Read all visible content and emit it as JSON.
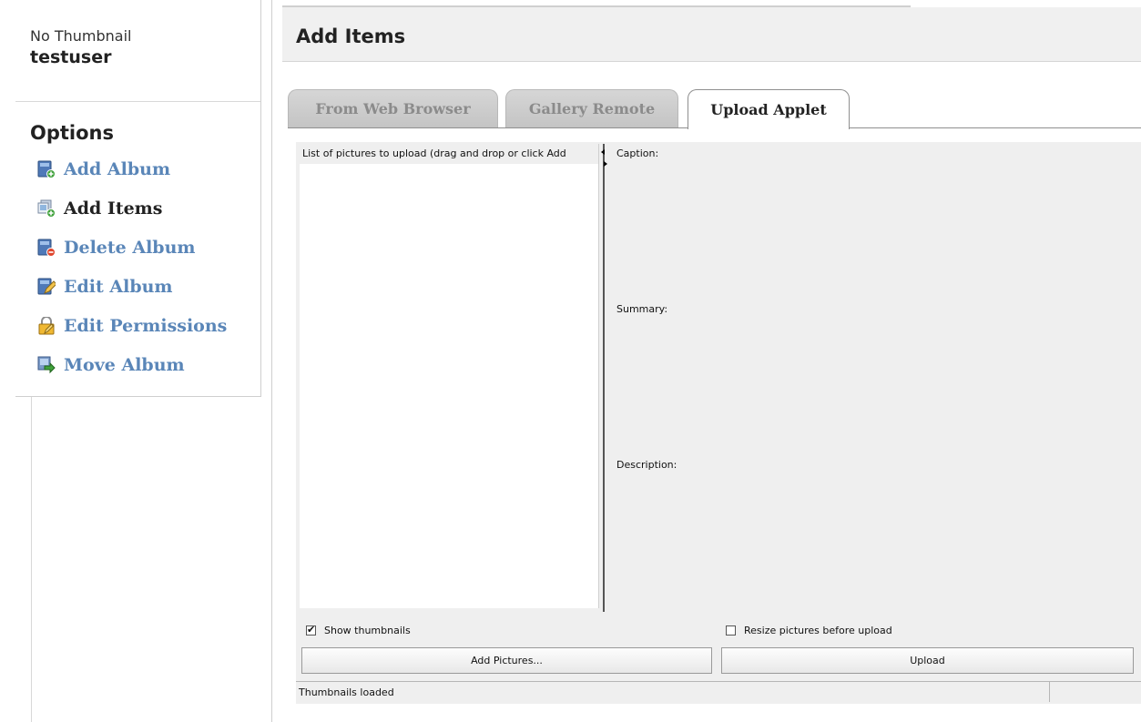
{
  "sidebar": {
    "thumbnail_label": "No Thumbnail",
    "username": "testuser",
    "options_title": "Options",
    "items": [
      {
        "label": "Add Album",
        "icon": "add-album-icon",
        "current": false
      },
      {
        "label": "Add Items",
        "icon": "add-items-icon",
        "current": true
      },
      {
        "label": "Delete Album",
        "icon": "delete-album-icon",
        "current": false
      },
      {
        "label": "Edit Album",
        "icon": "edit-album-icon",
        "current": false
      },
      {
        "label": "Edit Permissions",
        "icon": "edit-permissions-icon",
        "current": false
      },
      {
        "label": "Move Album",
        "icon": "move-album-icon",
        "current": false
      }
    ]
  },
  "main": {
    "title": "Add Items",
    "tabs": [
      {
        "label": "From Web Browser",
        "active": false
      },
      {
        "label": "Gallery Remote",
        "active": false
      },
      {
        "label": "Upload Applet",
        "active": true
      }
    ]
  },
  "applet": {
    "list_header": "List of pictures to upload (drag and drop or click Add",
    "caption_label": "Caption:",
    "summary_label": "Summary:",
    "description_label": "Description:",
    "show_thumbnails_label": "Show thumbnails",
    "show_thumbnails_checked": true,
    "resize_label": "Resize pictures before upload",
    "resize_checked": false,
    "add_pictures_label": "Add Pictures...",
    "upload_label": "Upload",
    "status_text": "Thumbnails loaded"
  },
  "colors": {
    "link": "#5a86b8",
    "header_bg": "#f0f0f0",
    "applet_bg": "#efefef",
    "tab_inactive_text": "#8b8b8b"
  }
}
